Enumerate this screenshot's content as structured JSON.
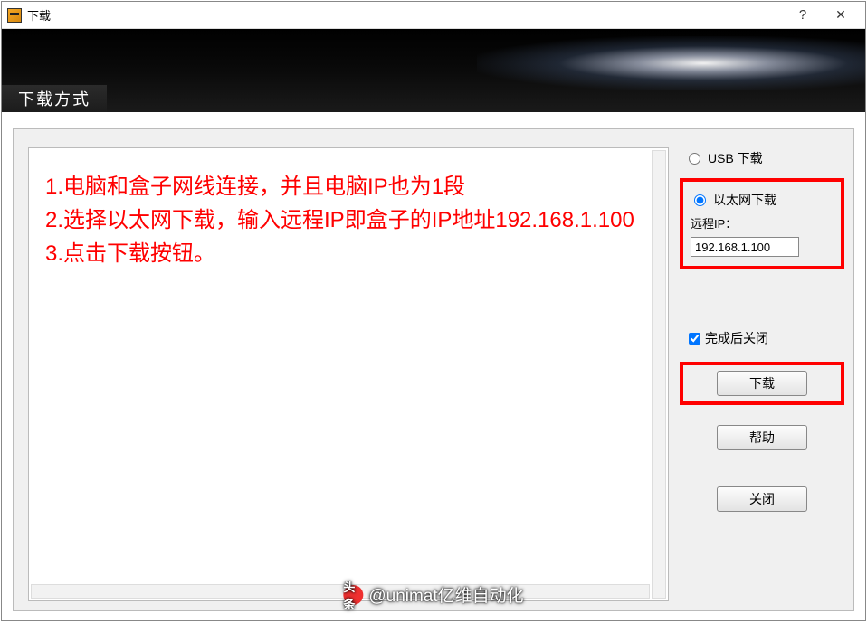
{
  "window": {
    "title": "下载",
    "help_symbol": "?",
    "close_symbol": "✕"
  },
  "banner": {
    "section_title": "下载方式"
  },
  "instructions": {
    "line1": "1.电脑和盒子网线连接，并且电脑IP也为1段",
    "line2": "2.选择以太网下载，输入远程IP即盒子的IP地址192.168.1.100",
    "line3": "3.点击下载按钮。"
  },
  "options": {
    "usb_label": "USB 下载",
    "ethernet_label": "以太网下载",
    "remote_ip_label": "远程IP：",
    "remote_ip_value": "192.168.1.100",
    "close_after_label": "完成后关闭",
    "close_after_checked": true,
    "selected_mode": "ethernet"
  },
  "buttons": {
    "download": "下载",
    "help": "帮助",
    "close": "关闭"
  },
  "watermark": {
    "prefix": "头条",
    "text": "@unimat亿维自动化"
  }
}
